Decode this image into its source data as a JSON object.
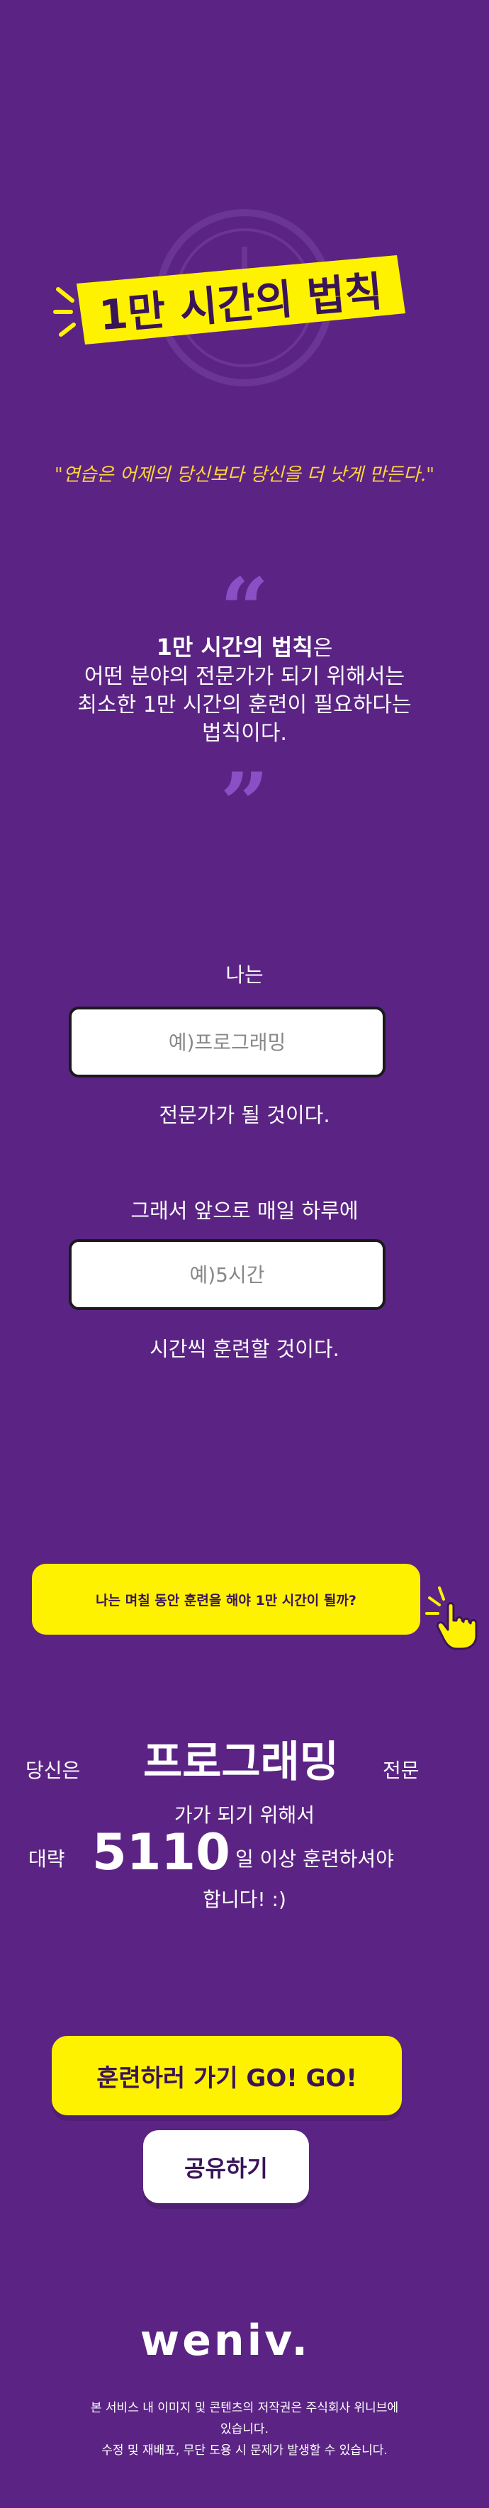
{
  "logo": {
    "title": "1만 시간의 법칙"
  },
  "quote": "\"연습은 어제의 당신보다 당신을 더 낫게 만든다.\"",
  "quote_marks": {
    "open": "“",
    "close": "”"
  },
  "definition": {
    "bold": "1만 시간의 법칙",
    "rest_line1": "은",
    "line2": "어떤 분야의 전문가가 되기 위해서는",
    "line3": "최소한 1만 시간의 훈련이 필요하다는",
    "line4": "법칙이다."
  },
  "form": {
    "label_i": "나는",
    "field_placeholder": "예)프로그래밍",
    "label_expert": "전문가가 될 것이다.",
    "label_so": "그래서 앞으로 매일 하루에",
    "hours_placeholder": "예)5시간",
    "label_train": "시간씩 훈련할 것이다."
  },
  "calc_button": "나는 며칠 동안 훈련을 해야 1만 시간이 될까?",
  "result": {
    "you": "당신은",
    "field": "프로그래밍",
    "expert": "전문",
    "line2": "가가 되기 위해서",
    "about": "대략",
    "days": "5110",
    "more": "일 이상 훈련하셔야",
    "line4": "합니다! :)"
  },
  "go_button": "훈련하러 가기 GO! GO!",
  "share_button": "공유하기",
  "brand": "weniv.",
  "footer": {
    "line1": "본 서비스 내 이미지 및 콘텐츠의 저작권은 주식회사 위니브에",
    "line2": "있습니다.",
    "line3": "수정 및 재배포, 무단 도용 시 문제가 발생할 수 있습니다."
  },
  "colors": {
    "background": "#5b2484",
    "accent_yellow": "#fff200",
    "quote_yellow": "#ffd43b",
    "dark_text": "#3a1458"
  }
}
